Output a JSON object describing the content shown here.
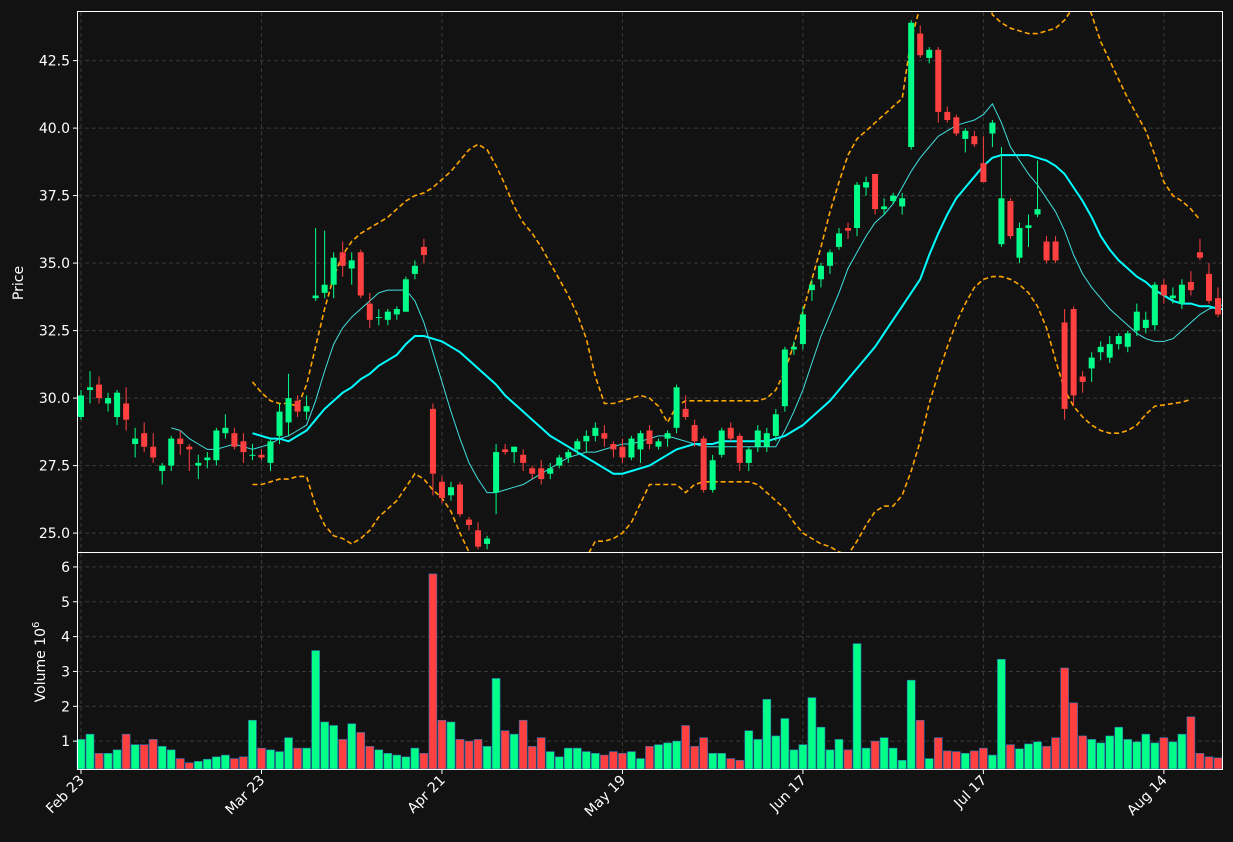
{
  "chart_data": {
    "type": "candlestick",
    "theme": {
      "background": "#121212",
      "up_color": "#00ff88",
      "down_color": "#ff4040",
      "grid": "dashed",
      "sma_short_color": "#40e0e0",
      "sma_long_color": "#00ffff",
      "band_color": "#ffa500"
    },
    "price_panel": {
      "ylabel": "Price",
      "ylim": [
        24.3,
        44.3
      ],
      "yticks": [
        "25.0",
        "27.5",
        "30.0",
        "32.5",
        "35.0",
        "37.5",
        "40.0",
        "42.5"
      ]
    },
    "volume_panel": {
      "ylabel": "Volume  10",
      "ylabel_exponent": "6",
      "ylim": [
        0.2,
        6.4
      ],
      "yticks": [
        "1",
        "2",
        "3",
        "4",
        "5",
        "6"
      ]
    },
    "xticks": [
      {
        "index": 0,
        "label": "Feb 23"
      },
      {
        "index": 20,
        "label": "Mar 23"
      },
      {
        "index": 40,
        "label": "Apr 21"
      },
      {
        "index": 60,
        "label": "May 19"
      },
      {
        "index": 80,
        "label": "Jun 17"
      },
      {
        "index": 100,
        "label": "Jul 17"
      },
      {
        "index": 120,
        "label": "Aug 14"
      }
    ],
    "candles": [
      [
        29.3,
        30.3,
        29.2,
        30.1,
        1.05
      ],
      [
        30.3,
        31.0,
        29.8,
        30.4,
        1.2
      ],
      [
        30.5,
        30.8,
        29.8,
        30.0,
        0.65
      ],
      [
        29.8,
        30.2,
        29.5,
        30.0,
        0.65
      ],
      [
        29.3,
        30.3,
        29.0,
        30.2,
        0.75
      ],
      [
        29.8,
        30.4,
        28.8,
        29.2,
        1.2
      ],
      [
        28.3,
        28.9,
        27.8,
        28.5,
        0.9
      ],
      [
        28.7,
        29.1,
        28.0,
        28.2,
        0.9
      ],
      [
        28.2,
        28.7,
        27.6,
        27.8,
        1.05
      ],
      [
        27.3,
        27.6,
        26.8,
        27.5,
        0.85
      ],
      [
        27.5,
        28.6,
        27.3,
        28.5,
        0.75
      ],
      [
        28.5,
        28.8,
        27.9,
        28.3,
        0.5
      ],
      [
        28.2,
        28.3,
        27.3,
        28.1,
        0.38
      ],
      [
        27.5,
        27.9,
        27.0,
        27.6,
        0.42
      ],
      [
        27.7,
        28.0,
        27.4,
        27.8,
        0.48
      ],
      [
        27.7,
        28.9,
        27.5,
        28.8,
        0.55
      ],
      [
        28.7,
        29.4,
        28.5,
        28.9,
        0.6
      ],
      [
        28.7,
        28.9,
        28.1,
        28.2,
        0.5
      ],
      [
        28.4,
        28.7,
        27.6,
        28.0,
        0.55
      ],
      [
        27.9,
        28.3,
        27.7,
        27.9,
        1.6
      ],
      [
        27.9,
        28.1,
        27.7,
        27.8,
        0.8
      ],
      [
        27.6,
        28.5,
        27.3,
        28.4,
        0.75
      ],
      [
        28.6,
        29.8,
        28.3,
        29.5,
        0.7
      ],
      [
        29.1,
        30.9,
        28.6,
        30.0,
        1.1
      ],
      [
        29.9,
        30.1,
        29.3,
        29.5,
        0.8
      ],
      [
        29.5,
        30.1,
        29.2,
        29.7,
        0.8
      ],
      [
        33.7,
        36.3,
        33.6,
        33.8,
        3.6
      ],
      [
        33.9,
        36.2,
        33.7,
        34.2,
        1.55
      ],
      [
        34.2,
        35.4,
        33.7,
        35.2,
        1.45
      ],
      [
        35.4,
        35.8,
        34.5,
        34.9,
        1.05
      ],
      [
        34.8,
        35.4,
        34.2,
        35.1,
        1.5
      ],
      [
        35.4,
        35.5,
        33.7,
        33.8,
        1.25
      ],
      [
        33.5,
        33.9,
        32.6,
        32.9,
        0.85
      ],
      [
        33.0,
        33.3,
        32.7,
        33.0,
        0.75
      ],
      [
        32.9,
        33.3,
        32.7,
        33.2,
        0.65
      ],
      [
        33.1,
        33.4,
        32.9,
        33.3,
        0.6
      ],
      [
        33.2,
        34.5,
        33.2,
        34.4,
        0.55
      ],
      [
        34.6,
        35.1,
        34.4,
        34.9,
        0.8
      ],
      [
        35.6,
        35.9,
        35.0,
        35.3,
        0.65
      ],
      [
        29.6,
        29.8,
        26.4,
        27.2,
        5.8
      ],
      [
        26.9,
        27.1,
        26.1,
        26.3,
        1.6
      ],
      [
        26.4,
        26.9,
        26.2,
        26.7,
        1.55
      ],
      [
        26.8,
        26.9,
        25.6,
        25.7,
        1.05
      ],
      [
        25.5,
        25.6,
        25.1,
        25.3,
        1.0
      ],
      [
        25.1,
        25.4,
        24.4,
        24.5,
        1.05
      ],
      [
        24.6,
        24.9,
        24.4,
        24.8,
        0.85
      ],
      [
        26.5,
        28.3,
        25.7,
        28.0,
        2.8
      ],
      [
        28.1,
        28.3,
        27.9,
        28.0,
        1.3
      ],
      [
        28.0,
        28.2,
        27.6,
        28.2,
        1.2
      ],
      [
        27.9,
        28.1,
        27.3,
        27.6,
        1.6
      ],
      [
        27.4,
        27.5,
        27.0,
        27.2,
        0.85
      ],
      [
        27.4,
        27.7,
        26.8,
        27.0,
        1.1
      ],
      [
        27.2,
        27.6,
        27.0,
        27.4,
        0.7
      ],
      [
        27.5,
        27.9,
        27.4,
        27.8,
        0.55
      ],
      [
        27.8,
        28.1,
        27.6,
        28.0,
        0.8
      ],
      [
        28.1,
        28.5,
        27.9,
        28.4,
        0.8
      ],
      [
        28.4,
        28.8,
        28.0,
        28.6,
        0.7
      ],
      [
        28.6,
        29.1,
        28.4,
        28.9,
        0.65
      ],
      [
        28.7,
        29.0,
        28.2,
        28.5,
        0.6
      ],
      [
        28.3,
        28.4,
        27.8,
        28.1,
        0.7
      ],
      [
        28.2,
        28.5,
        27.6,
        27.8,
        0.65
      ],
      [
        27.8,
        28.6,
        27.7,
        28.5,
        0.7
      ],
      [
        28.1,
        28.8,
        27.6,
        28.7,
        0.5
      ],
      [
        28.8,
        29.0,
        28.1,
        28.3,
        0.85
      ],
      [
        28.2,
        28.5,
        28.1,
        28.4,
        0.9
      ],
      [
        28.5,
        28.8,
        28.2,
        28.7,
        0.95
      ],
      [
        28.9,
        30.5,
        28.7,
        30.4,
        1.0
      ],
      [
        29.6,
        30.1,
        29.2,
        29.3,
        1.45
      ],
      [
        29.0,
        29.2,
        28.2,
        28.4,
        0.85
      ],
      [
        28.5,
        28.6,
        26.5,
        26.6,
        1.1
      ],
      [
        26.6,
        27.9,
        26.5,
        27.7,
        0.65
      ],
      [
        27.9,
        28.9,
        27.8,
        28.8,
        0.65
      ],
      [
        28.9,
        29.1,
        28.4,
        28.5,
        0.5
      ],
      [
        28.6,
        28.7,
        27.3,
        27.6,
        0.45
      ],
      [
        27.6,
        28.2,
        27.3,
        28.1,
        1.3
      ],
      [
        28.2,
        29.0,
        28.0,
        28.8,
        1.05
      ],
      [
        28.2,
        28.9,
        28.0,
        28.7,
        2.2
      ],
      [
        28.6,
        29.6,
        28.4,
        29.4,
        1.15
      ],
      [
        29.7,
        31.9,
        29.5,
        31.8,
        1.65
      ],
      [
        31.8,
        32.1,
        31.6,
        31.9,
        0.75
      ],
      [
        32.0,
        33.4,
        31.8,
        33.1,
        0.9
      ],
      [
        34.0,
        34.4,
        33.6,
        34.2,
        2.25
      ],
      [
        34.4,
        35.0,
        34.1,
        34.9,
        1.4
      ],
      [
        34.9,
        35.5,
        34.6,
        35.4,
        0.75
      ],
      [
        35.6,
        36.3,
        35.5,
        36.1,
        1.05
      ],
      [
        36.3,
        36.5,
        35.9,
        36.2,
        0.75
      ],
      [
        36.3,
        38.0,
        36.0,
        37.9,
        3.8
      ],
      [
        37.8,
        38.2,
        37.5,
        38.0,
        0.8
      ],
      [
        38.3,
        38.3,
        36.8,
        37.0,
        1.0
      ],
      [
        37.0,
        37.4,
        36.8,
        37.1,
        1.1
      ],
      [
        37.3,
        37.6,
        37.2,
        37.5,
        0.8
      ],
      [
        37.1,
        37.6,
        36.8,
        37.4,
        0.45
      ],
      [
        39.3,
        44.0,
        39.2,
        43.9,
        2.75
      ],
      [
        43.5,
        43.8,
        42.6,
        42.7,
        1.6
      ],
      [
        42.6,
        43.0,
        42.4,
        42.9,
        0.5
      ],
      [
        42.9,
        43.0,
        40.2,
        40.6,
        1.1
      ],
      [
        40.6,
        40.8,
        40.2,
        40.3,
        0.72
      ],
      [
        40.4,
        40.5,
        39.7,
        39.8,
        0.7
      ],
      [
        39.6,
        40.0,
        39.1,
        39.9,
        0.65
      ],
      [
        39.7,
        39.9,
        39.3,
        39.4,
        0.72
      ],
      [
        38.7,
        39.7,
        38.0,
        38.0,
        0.8
      ],
      [
        39.8,
        40.3,
        39.3,
        40.2,
        0.6
      ],
      [
        35.7,
        39.3,
        35.6,
        37.4,
        3.35
      ],
      [
        37.3,
        37.4,
        35.9,
        36.0,
        0.9
      ],
      [
        35.2,
        36.5,
        35.0,
        36.3,
        0.78
      ],
      [
        36.3,
        36.8,
        35.6,
        36.4,
        0.92
      ],
      [
        36.8,
        38.8,
        36.7,
        37.0,
        0.98
      ],
      [
        35.8,
        36.0,
        35.0,
        35.1,
        0.85
      ],
      [
        35.8,
        36.0,
        35.0,
        35.1,
        1.1
      ],
      [
        32.8,
        33.3,
        29.2,
        29.6,
        3.1
      ],
      [
        33.3,
        33.4,
        29.7,
        30.1,
        2.1
      ],
      [
        30.8,
        31.0,
        30.2,
        30.6,
        1.15
      ],
      [
        31.1,
        31.7,
        30.6,
        31.5,
        1.05
      ],
      [
        31.7,
        32.1,
        31.4,
        31.9,
        0.95
      ],
      [
        31.5,
        32.3,
        31.3,
        32.0,
        1.15
      ],
      [
        32.0,
        32.4,
        31.8,
        32.3,
        1.4
      ],
      [
        31.9,
        32.5,
        31.7,
        32.4,
        1.05
      ],
      [
        32.5,
        33.5,
        32.3,
        33.2,
        0.98
      ],
      [
        32.6,
        33.2,
        32.4,
        32.9,
        1.2
      ],
      [
        32.7,
        34.3,
        32.5,
        34.2,
        0.95
      ],
      [
        34.2,
        34.4,
        33.5,
        33.8,
        1.1
      ],
      [
        33.7,
        34.1,
        33.5,
        33.8,
        0.98
      ],
      [
        33.5,
        34.4,
        33.3,
        34.2,
        1.2
      ],
      [
        34.3,
        34.7,
        33.8,
        34.0,
        1.7
      ],
      [
        35.4,
        35.9,
        35.1,
        35.2,
        0.65
      ],
      [
        34.6,
        35.0,
        33.5,
        33.6,
        0.55
      ],
      [
        33.7,
        34.1,
        33.0,
        33.1,
        0.52
      ]
    ],
    "sma_short": [
      null,
      null,
      null,
      null,
      null,
      null,
      null,
      null,
      null,
      null,
      28.9,
      28.8,
      28.5,
      28.3,
      28.1,
      28.1,
      28.2,
      28.3,
      28.2,
      28.1,
      28.2,
      28.3,
      28.5,
      28.6,
      28.8,
      29.0,
      29.9,
      31.0,
      32.0,
      32.6,
      33.0,
      33.3,
      33.6,
      33.9,
      34.0,
      34.0,
      34.0,
      33.6,
      32.8,
      31.7,
      30.6,
      29.5,
      28.5,
      27.6,
      27.0,
      26.5,
      26.5,
      26.6,
      26.7,
      26.8,
      27.0,
      27.2,
      27.4,
      27.6,
      27.8,
      27.9,
      28.0,
      28.0,
      28.1,
      28.2,
      28.3,
      28.3,
      28.4,
      28.5,
      28.6,
      28.6,
      28.5,
      28.4,
      28.3,
      28.2,
      28.2,
      28.2,
      28.2,
      28.2,
      28.2,
      28.2,
      28.2,
      28.2,
      28.8,
      29.5,
      30.3,
      31.3,
      32.3,
      33.1,
      33.9,
      34.8,
      35.4,
      36.0,
      36.5,
      36.8,
      37.2,
      37.8,
      38.4,
      38.9,
      39.3,
      39.7,
      39.9,
      40.1,
      40.2,
      40.3,
      40.5,
      40.9,
      40.2,
      39.3,
      38.8,
      38.3,
      37.9,
      37.4,
      36.9,
      36.2,
      35.3,
      34.6,
      34.1,
      33.7,
      33.3,
      33.0,
      32.7,
      32.4,
      32.2,
      32.1,
      32.1,
      32.2,
      32.5,
      32.8,
      33.1,
      33.3,
      33.4,
      33.5
    ],
    "sma_long": [
      null,
      null,
      null,
      null,
      null,
      null,
      null,
      null,
      null,
      null,
      null,
      null,
      null,
      null,
      null,
      null,
      null,
      null,
      null,
      28.7,
      28.6,
      28.5,
      28.5,
      28.4,
      28.6,
      28.8,
      29.2,
      29.6,
      29.9,
      30.2,
      30.4,
      30.7,
      30.9,
      31.2,
      31.4,
      31.6,
      32.0,
      32.3,
      32.3,
      32.2,
      32.1,
      31.9,
      31.7,
      31.4,
      31.1,
      30.8,
      30.5,
      30.1,
      29.8,
      29.5,
      29.2,
      28.9,
      28.6,
      28.4,
      28.2,
      28.0,
      27.8,
      27.6,
      27.4,
      27.2,
      27.2,
      27.3,
      27.4,
      27.5,
      27.7,
      27.9,
      28.1,
      28.2,
      28.3,
      28.3,
      28.3,
      28.4,
      28.4,
      28.4,
      28.4,
      28.4,
      28.4,
      28.5,
      28.6,
      28.8,
      29.0,
      29.3,
      29.6,
      29.9,
      30.3,
      30.7,
      31.1,
      31.5,
      31.9,
      32.4,
      32.9,
      33.4,
      33.9,
      34.4,
      35.3,
      36.1,
      36.8,
      37.4,
      37.8,
      38.2,
      38.6,
      38.9,
      39.0,
      39.0,
      39.0,
      39.0,
      38.9,
      38.8,
      38.6,
      38.3,
      37.8,
      37.3,
      36.7,
      36.0,
      35.5,
      35.1,
      34.8,
      34.5,
      34.3,
      34.0,
      33.8,
      33.6,
      33.5,
      33.5,
      33.4,
      33.4,
      33.3,
      33.3
    ],
    "band_upper": [
      null,
      null,
      null,
      null,
      null,
      null,
      null,
      null,
      null,
      null,
      null,
      null,
      null,
      null,
      null,
      null,
      null,
      null,
      null,
      30.6,
      30.2,
      29.9,
      29.8,
      29.8,
      29.7,
      30.5,
      31.9,
      33.3,
      34.5,
      35.3,
      35.8,
      36.1,
      36.3,
      36.5,
      36.7,
      37.0,
      37.3,
      37.5,
      37.6,
      37.8,
      38.1,
      38.4,
      38.8,
      39.2,
      39.4,
      39.2,
      38.6,
      37.9,
      37.1,
      36.5,
      36.1,
      35.6,
      35.0,
      34.4,
      33.8,
      33.1,
      32.2,
      30.8,
      29.8,
      29.8,
      29.9,
      30.0,
      30.1,
      30.0,
      29.7,
      29.1,
      29.7,
      29.9,
      29.9,
      29.9,
      29.9,
      29.9,
      29.9,
      29.9,
      29.9,
      29.9,
      30.0,
      30.3,
      31.0,
      32.0,
      33.2,
      34.4,
      35.6,
      36.9,
      38.0,
      39.0,
      39.6,
      39.9,
      40.2,
      40.5,
      40.8,
      41.1,
      43.3,
      44.5,
      45.5,
      46.5,
      46.5,
      46.4,
      46.3,
      46.0,
      45.5,
      44.2,
      43.9,
      43.7,
      43.6,
      43.5,
      43.5,
      43.6,
      43.7,
      44.0,
      44.5,
      45.0,
      44.2,
      43.2,
      42.5,
      41.8,
      41.1,
      40.5,
      39.9,
      39.0,
      38.0,
      37.5,
      37.3,
      37.0,
      36.6
    ],
    "band_lower": [
      null,
      null,
      null,
      null,
      null,
      null,
      null,
      null,
      null,
      null,
      null,
      null,
      null,
      null,
      null,
      null,
      null,
      null,
      null,
      26.8,
      26.8,
      26.9,
      27.0,
      27.0,
      27.1,
      27.1,
      26.0,
      25.3,
      24.9,
      24.8,
      24.6,
      24.8,
      25.1,
      25.6,
      25.9,
      26.2,
      26.7,
      27.2,
      27.0,
      26.6,
      26.3,
      25.8,
      25.0,
      24.3,
      23.7,
      23.0,
      22.5,
      22.2,
      22.0,
      22.0,
      22.2,
      22.5,
      22.8,
      23.1,
      23.4,
      23.7,
      24.1,
      24.7,
      24.7,
      24.8,
      25.0,
      25.4,
      26.1,
      26.8,
      26.8,
      26.8,
      26.8,
      26.5,
      26.8,
      26.9,
      26.9,
      26.9,
      26.9,
      26.9,
      26.9,
      26.8,
      26.5,
      26.2,
      25.9,
      25.4,
      25.0,
      24.8,
      24.6,
      24.5,
      24.3,
      24.2,
      24.7,
      25.3,
      25.8,
      26.0,
      26.0,
      26.4,
      27.3,
      28.4,
      29.8,
      30.9,
      31.9,
      32.8,
      33.5,
      34.1,
      34.4,
      34.5,
      34.5,
      34.4,
      34.2,
      33.9,
      33.4,
      32.6,
      31.4,
      30.3,
      29.7,
      29.3,
      29.0,
      28.8,
      28.7,
      28.7,
      28.8,
      29.0,
      29.4,
      29.7,
      29.75,
      29.8,
      29.85,
      29.95
    ]
  }
}
